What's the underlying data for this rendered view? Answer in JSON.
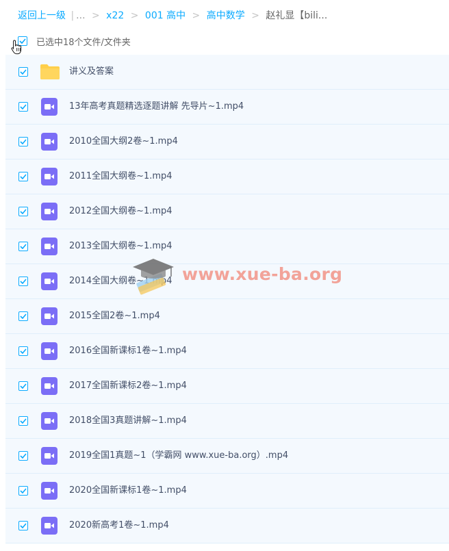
{
  "breadcrumb": {
    "back": "返回上一级",
    "divider": "|",
    "ellipsis": "...",
    "items": [
      "x22",
      "001 高中",
      "高中数学"
    ],
    "current": "赵礼显【bili..."
  },
  "selection": {
    "label": "已选中18个文件/文件夹",
    "checked": true
  },
  "files": [
    {
      "name": "讲义及答案",
      "type": "folder-icon",
      "checked": true
    },
    {
      "name": "13年高考真题精选逐题讲解 先导片~1.mp4",
      "type": "video-icon",
      "checked": true
    },
    {
      "name": "2010全国大纲2卷~1.mp4",
      "type": "video-icon",
      "checked": true
    },
    {
      "name": "2011全国大纲卷~1.mp4",
      "type": "video-icon",
      "checked": true
    },
    {
      "name": "2012全国大纲卷~1.mp4",
      "type": "video-icon",
      "checked": true
    },
    {
      "name": "2013全国大纲卷~1.mp4",
      "type": "video-icon",
      "checked": true
    },
    {
      "name": "2014全国大纲卷~1.mp4",
      "type": "video-icon",
      "checked": true
    },
    {
      "name": "2015全国2卷~1.mp4",
      "type": "video-icon",
      "checked": true
    },
    {
      "name": "2016全国新课标1卷~1.mp4",
      "type": "video-icon",
      "checked": true
    },
    {
      "name": "2017全国新课标2卷~1.mp4",
      "type": "video-icon",
      "checked": true
    },
    {
      "name": "2018全国3真题讲解~1.mp4",
      "type": "video-icon",
      "checked": true
    },
    {
      "name": "2019全国1真题~1（学霸网 www.xue-ba.org）.mp4",
      "type": "video-icon",
      "checked": true
    },
    {
      "name": "2020全国新课标1卷~1.mp4",
      "type": "video-icon",
      "checked": true
    },
    {
      "name": "2020新高考1卷~1.mp4",
      "type": "video-icon",
      "checked": true
    }
  ],
  "watermark": {
    "text": "www.xue-ba.org"
  },
  "colors": {
    "accent": "#09aaff",
    "row_background": "#f4f9fe",
    "video_icon": "#7b6ef6",
    "folder_icon": "#ffd24d"
  }
}
